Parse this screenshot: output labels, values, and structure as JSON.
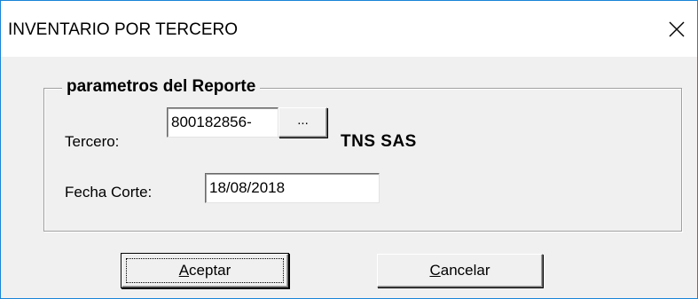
{
  "window": {
    "title": "INVENTARIO POR TERCERO",
    "close_icon": "close-icon"
  },
  "group": {
    "legend": "parametros del Reporte"
  },
  "tercero": {
    "label": "Tercero:",
    "value": "800182856-",
    "browse_label": "...",
    "name": "TNS SAS"
  },
  "fecha": {
    "label": "Fecha Corte:",
    "value": "18/08/2018"
  },
  "buttons": {
    "accept_first": "A",
    "accept_rest": "ceptar",
    "cancel_first": "C",
    "cancel_rest": "ancelar"
  }
}
